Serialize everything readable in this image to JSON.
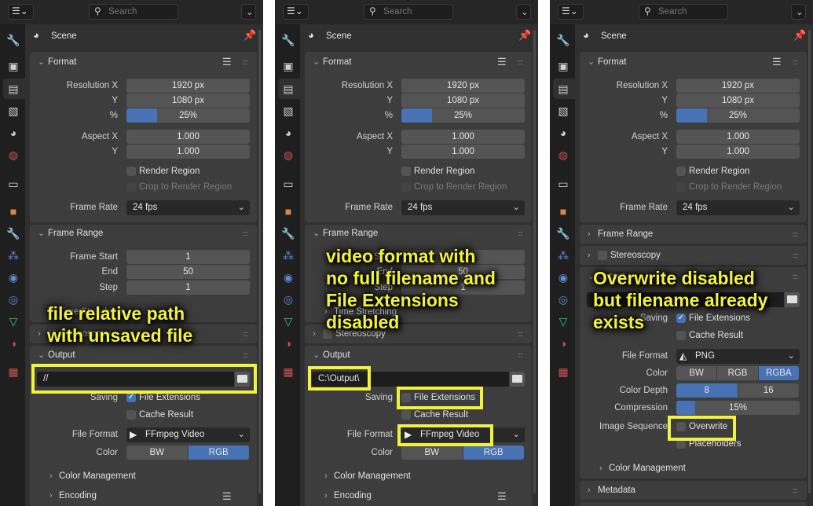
{
  "topbar": {
    "search_placeholder": "Search"
  },
  "context": {
    "title": "Scene"
  },
  "sidebar_icons": [
    "tool-icon",
    "render-icon",
    "output-icon",
    "view-layer-icon",
    "scene-icon",
    "world-icon",
    "collection-icon",
    "object-icon",
    "modifier-icon",
    "particles-icon",
    "physics-icon",
    "constraints-icon",
    "data-icon",
    "material-icon",
    "texture-icon"
  ],
  "colors": {
    "accent": "#4772b3",
    "annotation": "#f2f23a",
    "panel_bg": "#303030",
    "box_bg": "#3d3d3d"
  },
  "format": {
    "title": "Format",
    "resolution_x_label": "Resolution X",
    "resolution_x": "1920 px",
    "resolution_y_label": "Y",
    "resolution_y": "1080 px",
    "percent_label": "%",
    "percent": "25%",
    "percent_fraction": 0.25,
    "aspect_x_label": "Aspect X",
    "aspect_x": "1.000",
    "aspect_y_label": "Y",
    "aspect_y": "1.000",
    "render_region": "Render Region",
    "crop": "Crop to Render Region",
    "frame_rate_label": "Frame Rate",
    "frame_rate": "24 fps"
  },
  "frame_range": {
    "title": "Frame Range",
    "start_label": "Frame Start",
    "start": "1",
    "end_label": "End",
    "end": "50",
    "step_label": "Step",
    "step": "1",
    "time_stretching": "Time Stretching"
  },
  "stereoscopy": {
    "title": "Stereoscopy"
  },
  "metadata": {
    "title": "Metadata"
  },
  "output_labels": {
    "title": "Output",
    "saving_label": "Saving",
    "file_extensions": "File Extensions",
    "cache_result": "Cache Result",
    "file_format_label": "File Format",
    "color_label": "Color",
    "color_depth_label": "Color Depth",
    "compression_label": "Compression",
    "image_sequence_label": "Image Sequence",
    "overwrite": "Overwrite",
    "placeholders": "Placeholders",
    "color_management": "Color Management",
    "encoding": "Encoding"
  },
  "panels": [
    {
      "output": {
        "path": "//",
        "file_extensions_checked": true,
        "cache_result_checked": false,
        "file_format": "FFmpeg Video",
        "color_options": [
          "BW",
          "RGB"
        ],
        "color_active": "RGB"
      },
      "annotation": "file relative path\nwith unsaved file"
    },
    {
      "output": {
        "path": "C:\\Output\\",
        "file_extensions_checked": false,
        "cache_result_checked": false,
        "file_format": "FFmpeg Video",
        "color_options": [
          "BW",
          "RGB"
        ],
        "color_active": "RGB"
      },
      "annotation": "video format with\nno full filename and\nFile Extensions\ndisabled"
    },
    {
      "output": {
        "path": "",
        "file_extensions_checked": true,
        "cache_result_checked": false,
        "file_format": "PNG",
        "color_options": [
          "BW",
          "RGB",
          "RGBA"
        ],
        "color_active": "RGBA",
        "color_depth_options": [
          "8",
          "16"
        ],
        "color_depth_active": "8",
        "compression": "15%",
        "compression_fraction": 0.15,
        "overwrite_checked": false,
        "placeholders_checked": false
      },
      "annotation": "Overwrite disabled\nbut filename already\nexists"
    }
  ]
}
